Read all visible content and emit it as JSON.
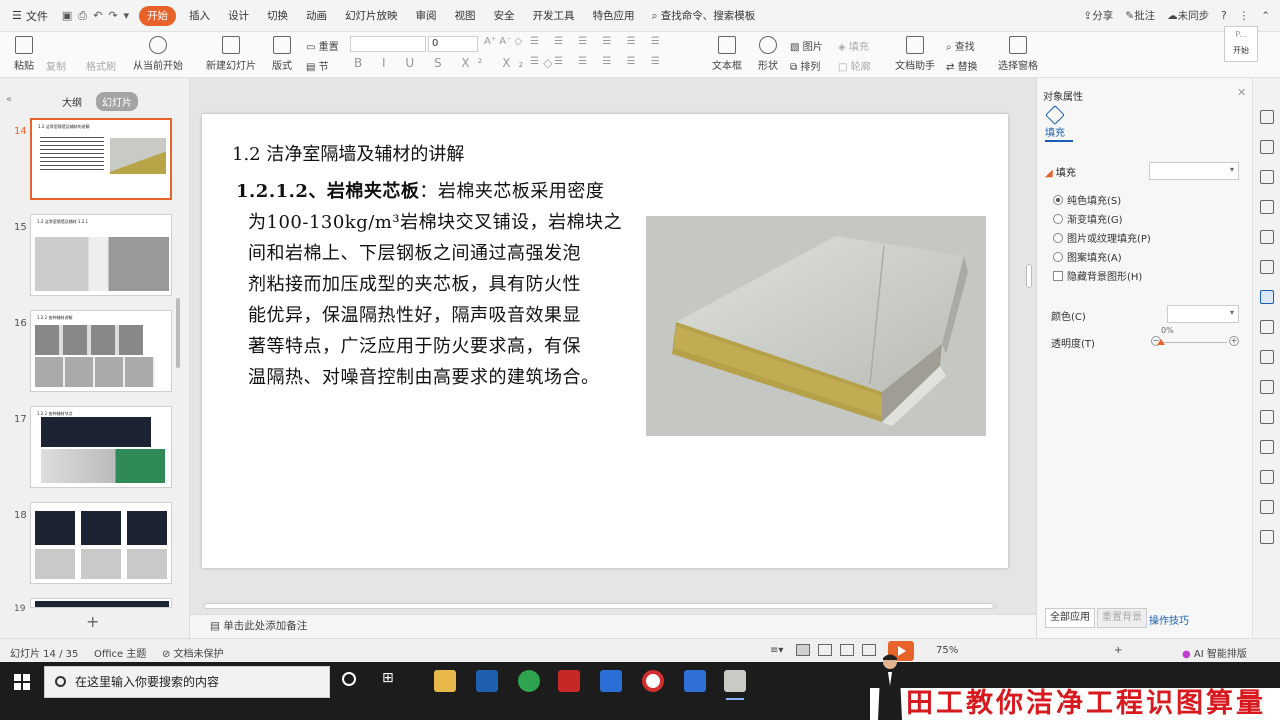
{
  "menubar": {
    "file_label": "文件",
    "tabs": [
      "开始",
      "插入",
      "设计",
      "切换",
      "动画",
      "幻灯片放映",
      "审阅",
      "视图",
      "安全",
      "开发工具",
      "特色应用"
    ],
    "active_tab": "开始",
    "search_label": "查找命令、搜索模板",
    "share_label": "分享",
    "comment_label": "批注",
    "sync_label": "未同步"
  },
  "ribbon": {
    "paste": "粘贴",
    "copy": "复制",
    "format_painter": "格式刷",
    "from_current": "从当前开始",
    "new_slide": "新建幻灯片",
    "layout": "版式",
    "reset": "重置",
    "section": "节",
    "font_size": "0",
    "textbox": "文本框",
    "shape": "形状",
    "picture": "图片",
    "fill": "填充",
    "arrange": "排列",
    "outline": "轮廓",
    "doc_assistant": "文档助手",
    "find": "查找",
    "replace": "替换",
    "select_pane": "选择窗格",
    "float_top": "P...",
    "float_label": "开始"
  },
  "left_panel": {
    "tab_outline": "大纲",
    "tab_slides": "幻灯片",
    "thumbnails": [
      {
        "num": "14",
        "title": "1.2 洁净室隔墙及辅材的讲解",
        "selected": true
      },
      {
        "num": "15",
        "title": "1.2 洁净室隔墙及辅材 1.2.1",
        "selected": false
      },
      {
        "num": "16",
        "title": "1.2.2 各种辅材讲解",
        "selected": false
      },
      {
        "num": "17",
        "title": "1.2.2 各种辅材节点",
        "selected": false
      },
      {
        "num": "18",
        "title": "",
        "selected": false
      },
      {
        "num": "19",
        "title": "",
        "selected": false
      }
    ]
  },
  "slide": {
    "title": "1.2 洁净室隔墙及辅材的讲解",
    "heading": "1.2.1.2、岩棉夹芯板",
    "line1": "：岩棉夹芯板采用密度",
    "lines": [
      "为100-130kg/m³岩棉块交叉铺设，岩棉块之",
      "间和岩棉上、下层钢板之间通过高强发泡",
      "剂粘接而加压成型的夹芯板，具有防火性",
      "能优异，保温隔热性好，隔声吸音效果显",
      "著等特点，广泛应用于防火要求高，有保",
      "温隔热、对噪音控制由高要求的建筑场合。"
    ]
  },
  "notes_placeholder": "单击此处添加备注",
  "right_panel": {
    "title": "对象属性",
    "tab_fill": "填充",
    "section_fill": "填充",
    "options": [
      "纯色填充(S)",
      "渐变填充(G)",
      "图片或纹理填充(P)",
      "图案填充(A)"
    ],
    "hide_bg": "隐藏背景图形(H)",
    "color_label": "颜色(C)",
    "transparency_label": "透明度(T)",
    "transparency_value": "0%",
    "transparency_percent": 0,
    "apply_all": "全部应用",
    "reset_bg": "重置背景",
    "tips": "操作技巧"
  },
  "status": {
    "slide_info": "幻灯片 14 / 35",
    "theme": "Office 主题",
    "doc_status": "文档未保护",
    "zoom": "75%",
    "ai_label": "AI 智能排版"
  },
  "taskbar": {
    "search_placeholder": "在这里输入你要搜索的内容"
  },
  "banner": {
    "text": "田工教你洁净工程识图算量"
  },
  "colors": {
    "accent": "#e8632a",
    "link": "#1a5fb4",
    "banner_red": "#d8191e"
  }
}
